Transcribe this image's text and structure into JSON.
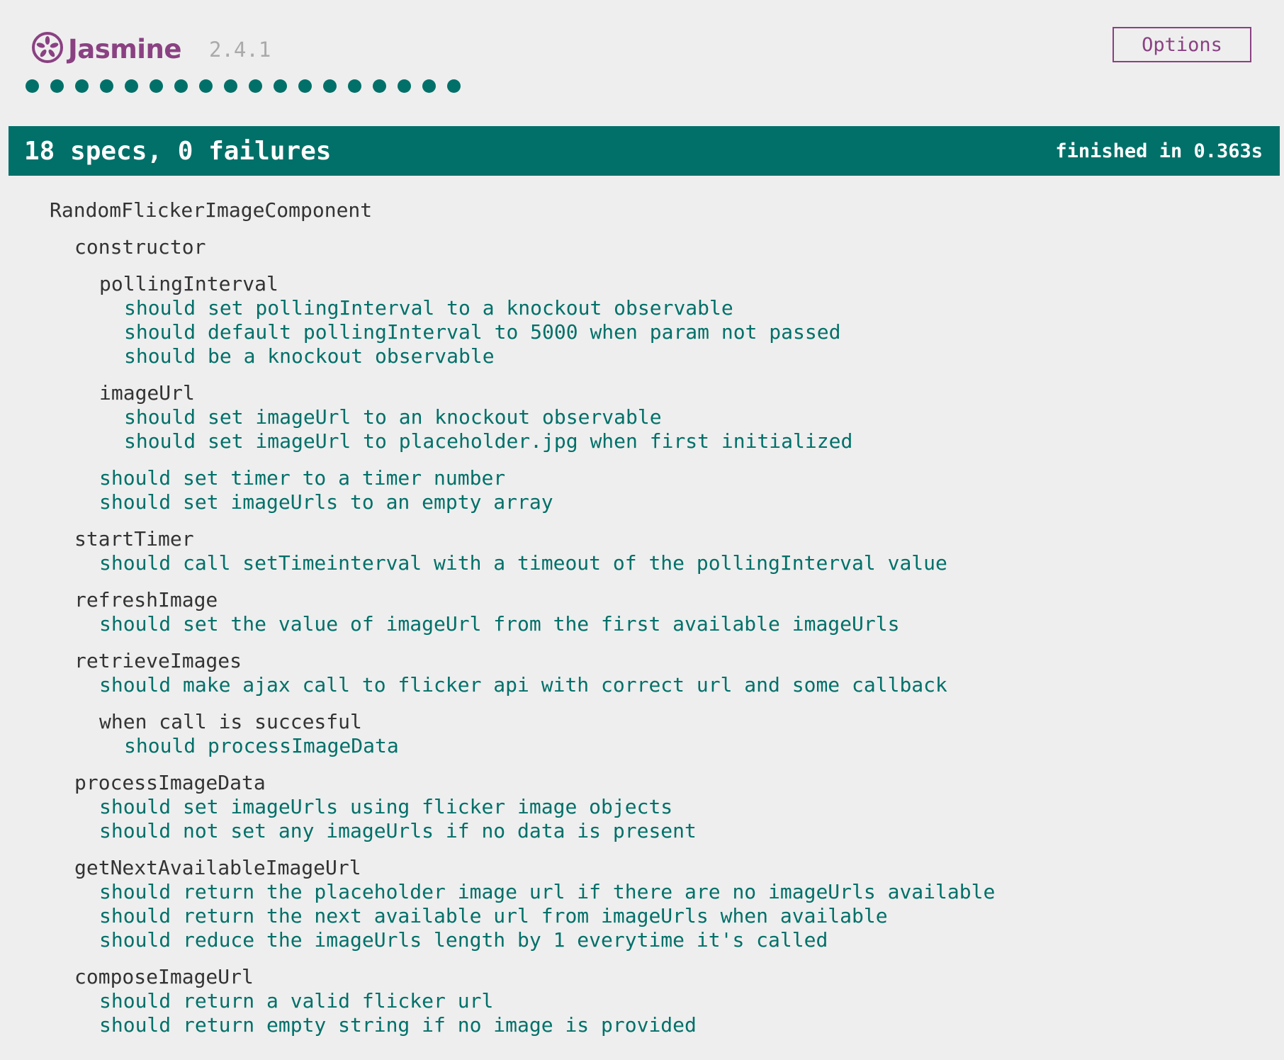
{
  "header": {
    "logo_text": "Jasmine",
    "version": "2.4.1",
    "options_label": "Options",
    "spec_dot_count": 18,
    "passed_color": "#007069",
    "brand_color": "#8a4182"
  },
  "summary": {
    "text": "18 specs, 0 failures",
    "duration": "finished in 0.363s"
  },
  "results": [
    {
      "kind": "suite",
      "depth": 0,
      "text": "RandomFlickerImageComponent"
    },
    {
      "kind": "suite",
      "depth": 1,
      "text": "constructor"
    },
    {
      "kind": "suite",
      "depth": 2,
      "text": "pollingInterval"
    },
    {
      "kind": "spec",
      "depth": 3,
      "text": "should set pollingInterval to a knockout observable"
    },
    {
      "kind": "spec",
      "depth": 3,
      "text": "should default pollingInterval to 5000 when param not passed"
    },
    {
      "kind": "spec",
      "depth": 3,
      "text": "should be a knockout observable"
    },
    {
      "kind": "suite",
      "depth": 2,
      "text": "imageUrl"
    },
    {
      "kind": "spec",
      "depth": 3,
      "text": "should set imageUrl to an knockout observable"
    },
    {
      "kind": "spec",
      "depth": 3,
      "text": "should set imageUrl to placeholder.jpg when first initialized"
    },
    {
      "kind": "spec",
      "depth": 2,
      "text": "should set timer to a timer number"
    },
    {
      "kind": "spec",
      "depth": 2,
      "text": "should set imageUrls to an empty array"
    },
    {
      "kind": "suite",
      "depth": 1,
      "text": "startTimer"
    },
    {
      "kind": "spec",
      "depth": 2,
      "text": "should call setTimeinterval with a timeout of the pollingInterval value"
    },
    {
      "kind": "suite",
      "depth": 1,
      "text": "refreshImage"
    },
    {
      "kind": "spec",
      "depth": 2,
      "text": "should set the value of imageUrl from the first available imageUrls"
    },
    {
      "kind": "suite",
      "depth": 1,
      "text": "retrieveImages"
    },
    {
      "kind": "spec",
      "depth": 2,
      "text": "should make ajax call to flicker api with correct url and some callback"
    },
    {
      "kind": "suite",
      "depth": 2,
      "text": "when call is succesful"
    },
    {
      "kind": "spec",
      "depth": 3,
      "text": "should processImageData"
    },
    {
      "kind": "suite",
      "depth": 1,
      "text": "processImageData"
    },
    {
      "kind": "spec",
      "depth": 2,
      "text": "should set imageUrls using flicker image objects"
    },
    {
      "kind": "spec",
      "depth": 2,
      "text": "should not set any imageUrls if no data is present"
    },
    {
      "kind": "suite",
      "depth": 1,
      "text": "getNextAvailableImageUrl"
    },
    {
      "kind": "spec",
      "depth": 2,
      "text": "should return the placeholder image url if there are no imageUrls available"
    },
    {
      "kind": "spec",
      "depth": 2,
      "text": "should return the next available url from imageUrls when available"
    },
    {
      "kind": "spec",
      "depth": 2,
      "text": "should reduce the imageUrls length by 1 everytime it's called"
    },
    {
      "kind": "suite",
      "depth": 1,
      "text": "composeImageUrl"
    },
    {
      "kind": "spec",
      "depth": 2,
      "text": "should return a valid flicker url"
    },
    {
      "kind": "spec",
      "depth": 2,
      "text": "should return empty string if no image is provided"
    }
  ]
}
